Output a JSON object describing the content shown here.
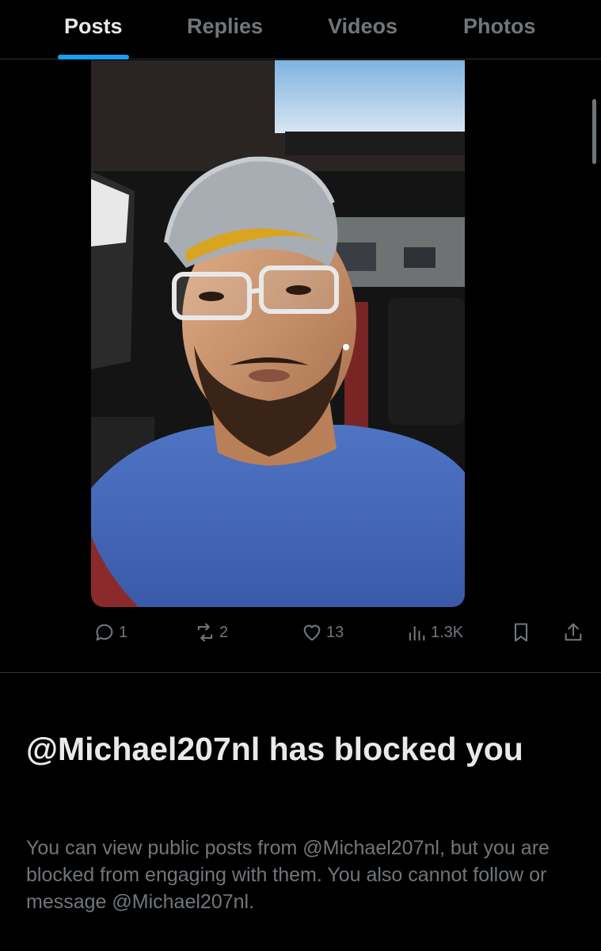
{
  "tabs": [
    {
      "label": "Posts",
      "active": true
    },
    {
      "label": "Replies",
      "active": false
    },
    {
      "label": "Videos",
      "active": false
    },
    {
      "label": "Photos",
      "active": false
    }
  ],
  "post": {
    "media_alt": "Selfie of a man wearing a cap and clear glasses in a car",
    "actions": {
      "reply_count": "1",
      "repost_count": "2",
      "like_count": "13",
      "views_count": "1.3K"
    },
    "icons": [
      "reply-icon",
      "repost-icon",
      "like-icon",
      "views-icon",
      "bookmark-icon",
      "share-icon"
    ]
  },
  "blocked": {
    "title": "@Michael207nl has blocked you",
    "description": "You can view public posts from @Michael207nl, but you are blocked from engaging with them. You also cannot follow or message @Michael207nl."
  },
  "colors": {
    "background": "#000000",
    "accent": "#1d9bf0",
    "primary_text": "#e7e9ea",
    "secondary_text": "#71767b",
    "border": "#2f3336"
  }
}
